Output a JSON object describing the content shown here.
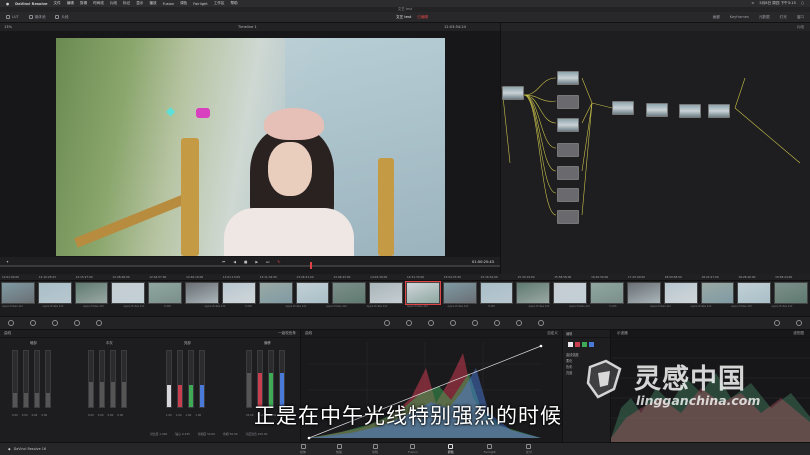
{
  "menubar": {
    "app_name": "DaVinci Resolve",
    "items": [
      "文件",
      "编辑",
      "剪辑",
      "时间线",
      "片段",
      "标记",
      "显示",
      "播放",
      "Fusion",
      "调色",
      "Fairlight",
      "工作区",
      "帮助"
    ],
    "clock": "5月8日 周四 下午3:15"
  },
  "window_title": "文艺 test",
  "toolbar": {
    "left_items": [
      "LUT",
      "媒体池",
      "片段"
    ],
    "project_name": "文艺 test",
    "project_status": "已编辑",
    "right_items": [
      "画廊",
      "Keyframes",
      "元数据",
      "灯光",
      "窗口"
    ]
  },
  "viewer": {
    "zoom": "13%",
    "timeline_name": "Timeline 1",
    "timecode_top": "12:03:54:24",
    "timecode": "01:00:25:43"
  },
  "node_editor": {
    "mode_label": "片段"
  },
  "clip_strip": {
    "timecodes": [
      "12:01:00:00",
      "12:10:25:03",
      "12:15:27:00",
      "12:28:48:00",
      "12:44:57:00",
      "12:46:19:00",
      "13:01:13:00",
      "13:11:32:00",
      "13:26:31:00",
      "13:49:43:00",
      "14:02:36:00",
      "14:31:33:00",
      "15:04:47:00",
      "15:16:32:00",
      "15:30:19:00",
      "15:58:58:00",
      "16:20:59:00",
      "17:43:40:00",
      "18:09:58:00",
      "18:24:47:00",
      "18:26:40:00",
      "18:38:44:00"
    ],
    "labels": [
      "Apple ProRes 422",
      "Apple ProRes 422",
      "Apple ProRes 422",
      "Apple ProRes 422",
      "H.265",
      "Apple ProRes 422",
      "H.265",
      "Apple ProRes 422",
      "Apple ProRes 422",
      "Apple ProRes 422",
      "Apple ProRes 422",
      "Apple ProRes 422",
      "H.265",
      "Apple ProRes 422",
      "Apple ProRes 422",
      "H.265",
      "Apple ProRes 422",
      "Apple ProRes 422",
      "Apple ProRes 422",
      "Apple ProRes 422"
    ]
  },
  "color_wheels": {
    "panel_title": "曲线",
    "mode_label": "一级校色条",
    "groups": [
      {
        "name": "暗部",
        "values": [
          "0.00",
          "0.00",
          "0.00",
          "0.00"
        ]
      },
      {
        "name": "中灰",
        "values": [
          "0.00",
          "0.00",
          "0.00",
          "0.00"
        ]
      },
      {
        "name": "亮部",
        "values": [
          "1.00",
          "1.00",
          "1.00",
          "1.00"
        ]
      },
      {
        "name": "偏移",
        "values": [
          "25.00",
          "25.00",
          "25.00",
          "25.00"
        ]
      }
    ],
    "footer": [
      "对比度 1.000",
      "轴心 0.435",
      "饱和度 50.00",
      "色相 50.00",
      "亮度混合 100.00"
    ]
  },
  "curves": {
    "title": "曲线",
    "panel_label": "自定义"
  },
  "channels": {
    "title": "编辑",
    "labels": [
      "曲线强度",
      "柔化",
      "色彩",
      "亮度"
    ]
  },
  "scope": {
    "title": "示波器",
    "mode": "波形图"
  },
  "page_nav": {
    "app_label": "DaVinci Resolve 16",
    "pages": [
      {
        "name": "媒体",
        "active": false
      },
      {
        "name": "快编",
        "active": false
      },
      {
        "name": "剪辑",
        "active": false
      },
      {
        "name": "Fusion",
        "active": false
      },
      {
        "name": "调色",
        "active": true
      },
      {
        "name": "Fairlight",
        "active": false
      },
      {
        "name": "交付",
        "active": false
      }
    ]
  },
  "subtitle": "正是在中午光线特别强烈的时候",
  "watermark": {
    "cn": "灵感中国",
    "en": "lingganchina.com"
  },
  "colors": {
    "accent_red": "#e04444",
    "curve_red": "#c8404f",
    "curve_green": "#3faa55",
    "curve_blue": "#4a7ad8"
  }
}
